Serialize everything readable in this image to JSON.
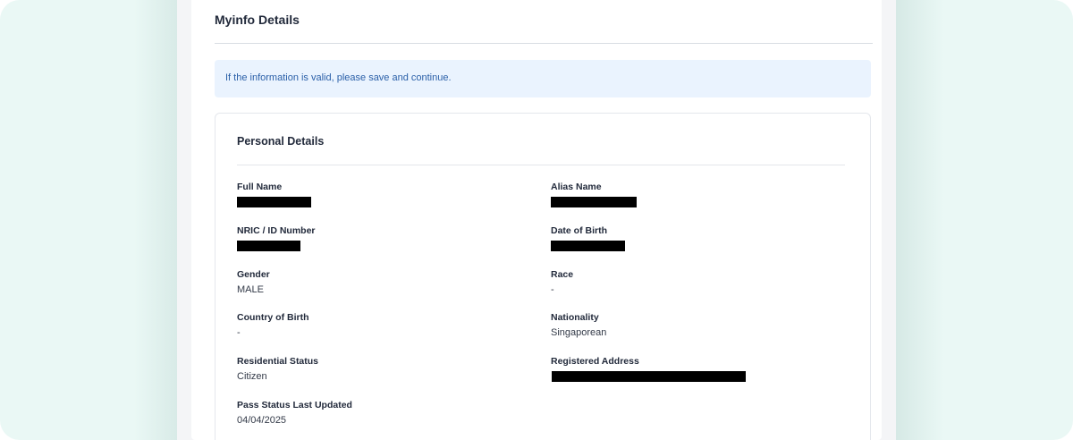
{
  "page": {
    "title": "Myinfo Details",
    "alert_text": "If the information is valid, please save and continue."
  },
  "personal_details": {
    "title": "Personal Details",
    "fields": {
      "full_name": {
        "label": "Full Name",
        "redacted": true
      },
      "alias_name": {
        "label": "Alias Name",
        "redacted": true
      },
      "nric": {
        "label": "NRIC / ID Number",
        "redacted": true
      },
      "dob": {
        "label": "Date of Birth",
        "redacted": true
      },
      "gender": {
        "label": "Gender",
        "value": "MALE"
      },
      "race": {
        "label": "Race",
        "value": "-"
      },
      "country_of_birth": {
        "label": "Country of Birth",
        "value": "-"
      },
      "nationality": {
        "label": "Nationality",
        "value": "Singaporean"
      },
      "residential_status": {
        "label": "Residential Status",
        "value": "Citizen"
      },
      "registered_address": {
        "label": "Registered Address",
        "redacted": true
      },
      "pass_status_last_updated": {
        "label": "Pass Status Last Updated",
        "value": "04/04/2025"
      }
    }
  },
  "colors": {
    "backdrop": "#eaf8f5",
    "alert_bg": "#eaf3fe",
    "alert_text": "#2a5fa8",
    "heading": "#222a3b",
    "redaction": "#000000"
  }
}
